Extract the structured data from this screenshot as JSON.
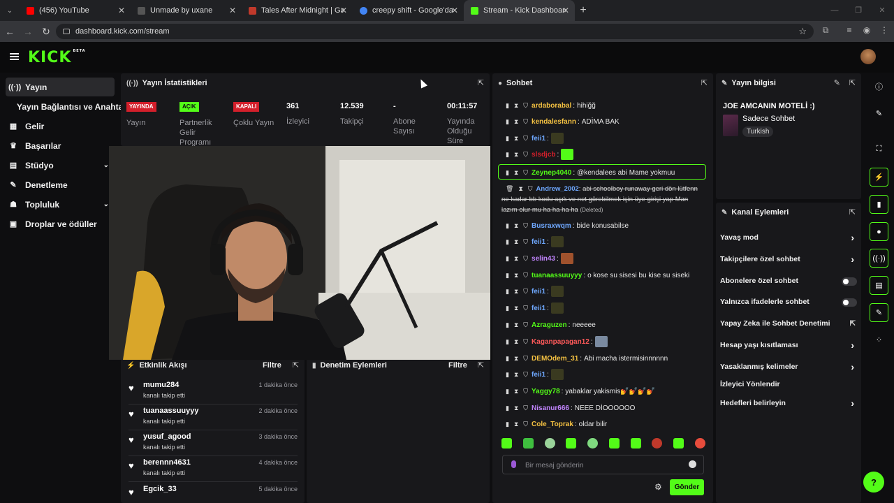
{
  "browser": {
    "tabs": [
      {
        "title": "(456) YouTube",
        "color": "#ff0000"
      },
      {
        "title": "Unmade by uxane",
        "color": "#333333"
      },
      {
        "title": "Tales After Midnight | Gas At Ni",
        "color": "#c0392b"
      },
      {
        "title": "creepy shift - Google'da Ara",
        "color": "#4285f4"
      },
      {
        "title": "Stream - Kick Dashboard",
        "color": "#53fc18"
      }
    ],
    "active_tab": 4,
    "url": "dashboard.kick.com/stream"
  },
  "kick": {
    "logo": "KICK",
    "beta": "BETA"
  },
  "sidebar": {
    "items": [
      {
        "label": "Yayın",
        "icon": "broadcast-icon",
        "glyph": "((·))"
      },
      {
        "label": "Yayın Bağlantısı ve Anahtarı",
        "icon": "",
        "glyph": ""
      },
      {
        "label": "Gelir",
        "icon": "revenue-icon",
        "glyph": "▦"
      },
      {
        "label": "Başarılar",
        "icon": "trophy-icon",
        "glyph": "🏆"
      },
      {
        "label": "Stüdyo",
        "icon": "studio-icon",
        "glyph": "▤"
      },
      {
        "label": "Denetleme",
        "icon": "wrench-icon",
        "glyph": "🔧"
      },
      {
        "label": "Topluluk",
        "icon": "community-icon",
        "glyph": "👥"
      },
      {
        "label": "Droplar ve ödüller",
        "icon": "gift-icon",
        "glyph": "🎁"
      }
    ]
  },
  "stats": {
    "title": "Yayın İstatistikleri",
    "items": [
      {
        "badge": "YAYINDA",
        "badge_color": "#d31f2b",
        "label": "Yayın"
      },
      {
        "badge": "AÇIK",
        "badge_color": "#53fc18",
        "label": "Partnerlik Gelir Programı"
      },
      {
        "badge": "KAPALI",
        "badge_color": "#d31f2b",
        "label": "Çoklu Yayın"
      },
      {
        "value": "361",
        "label": "İzleyici"
      },
      {
        "value": "12.539",
        "label": "Takipçi"
      },
      {
        "value": "-",
        "label": "Abone Sayısı"
      },
      {
        "value": "00:11:57",
        "label": "Yayında Olduğu Süre"
      }
    ]
  },
  "events": {
    "title": "Etkinlik Akışı",
    "filter": "Filtre",
    "items": [
      {
        "user": "mumu284",
        "desc": "kanalı takip etti",
        "time": "1 dakika önce"
      },
      {
        "user": "tuanaassuuyyy",
        "desc": "kanalı takip etti",
        "time": "2 dakika önce"
      },
      {
        "user": "yusuf_agood",
        "desc": "kanalı takip etti",
        "time": "3 dakika önce"
      },
      {
        "user": "berennn4631",
        "desc": "kanalı takip etti",
        "time": "4 dakika önce"
      },
      {
        "user": "Egcik_33",
        "desc": "",
        "time": "5 dakika önce"
      }
    ]
  },
  "moderation": {
    "title": "Denetim Eylemleri",
    "filter": "Filtre"
  },
  "chat": {
    "title": "Sohbet",
    "messages": [
      {
        "user": "ardaborabal",
        "color": "#f5c242",
        "text": "hihiğğ"
      },
      {
        "user": "kendalesfann",
        "color": "#f5c242",
        "text": "ADİMA BAK"
      },
      {
        "user": "feii1",
        "color": "#6fa8ff",
        "text": "",
        "emote": "#3a3a20"
      },
      {
        "user": "slsdjcb",
        "color": "#d31f2b",
        "text": "",
        "emote": "#53fc18"
      },
      {
        "user": "Zeynep4040",
        "color": "#53fc18",
        "text": "@kendalees abi Mame yokmuu"
      },
      {
        "user": "Busraxwqm",
        "color": "#6fa8ff",
        "text": "bide konusabilse"
      },
      {
        "user": "feii1",
        "color": "#6fa8ff",
        "text": "",
        "emote": "#3a3a20"
      },
      {
        "user": "selin43",
        "color": "#c084fc",
        "text": "",
        "emote": "#a0522d"
      },
      {
        "user": "tuanaassuuyyy",
        "color": "#53fc18",
        "text": "o kose su sisesi bu kise su siseki"
      },
      {
        "user": "feii1",
        "color": "#6fa8ff",
        "text": "",
        "emote": "#3a3a20"
      },
      {
        "user": "feii1",
        "color": "#6fa8ff",
        "text": "",
        "emote": "#3a3a20"
      },
      {
        "user": "Azraguzen",
        "color": "#53fc18",
        "text": "neeeee"
      },
      {
        "user": "Kaganpapagan12",
        "color": "#ff5a5a",
        "text": "",
        "emote": "#7a8aa0"
      },
      {
        "user": "DEMOdem_31",
        "color": "#f5c242",
        "text": "Abi macha istermisinnnnnn"
      },
      {
        "user": "feii1",
        "color": "#6fa8ff",
        "text": "",
        "emote": "#3a3a20"
      },
      {
        "user": "Yaggy78",
        "color": "#53fc18",
        "text": "yabaklar yakismis💅💅💅💅"
      },
      {
        "user": "Nisanur666",
        "color": "#c084fc",
        "text": "NEEE DİOOOOOO"
      },
      {
        "user": "Cole_Toprak",
        "color": "#f5c242",
        "text": "oldar bilir"
      }
    ],
    "deleted": {
      "user": "Andrew_2002",
      "text": "abi schoolboy runaway geri dön lütfenn ne kadar bb kodu açık ve net görebilmek için üye girişi yap Man lazım olur mu ha ha ha ha",
      "tag": "(Deleted)"
    },
    "placeholder": "Bir mesaj gönderin",
    "send": "Gönder"
  },
  "stream_info": {
    "title": "Yayın bilgisi",
    "stream_title": "JOE AMCANIN MOTELİ :)",
    "category": "Sadece Sohbet",
    "tag": "Turkish"
  },
  "channel_actions": {
    "title": "Kanal Eylemleri",
    "items": [
      {
        "label": "Yavaş mod",
        "control": "chevron"
      },
      {
        "label": "Takipçilere özel sohbet",
        "control": "chevron"
      },
      {
        "label": "Abonelere özel sohbet",
        "control": "toggle"
      },
      {
        "label": "Yalnızca ifadelerle sohbet",
        "control": "toggle"
      },
      {
        "label": "Yapay Zeka ile Sohbet Denetimi",
        "control": "external"
      },
      {
        "label": "Hesap yaşı kısıtlaması",
        "control": "chevron"
      },
      {
        "label": "Yasaklanmış kelimeler",
        "control": "chevron"
      },
      {
        "label": "İzleyici Yönlendir",
        "control": "none"
      },
      {
        "label": "Hedefleri belirleyin",
        "control": "chevron"
      }
    ]
  },
  "colors": {
    "accent": "#53fc18",
    "live": "#d31f2b"
  }
}
